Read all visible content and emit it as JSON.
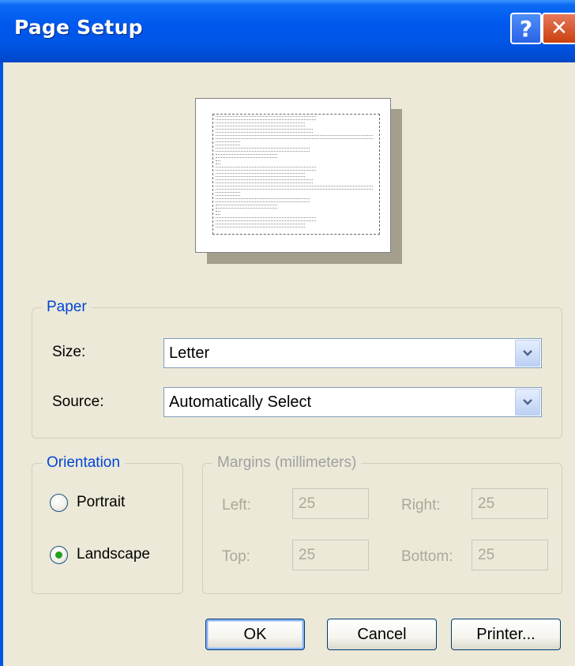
{
  "window": {
    "title": "Page Setup",
    "help_glyph": "?",
    "close_glyph": "✕"
  },
  "paper": {
    "group_title": "Paper",
    "size_label": "Size:",
    "size_value": "Letter",
    "source_label": "Source:",
    "source_value": "Automatically Select"
  },
  "orientation": {
    "group_title": "Orientation",
    "portrait_label": "Portrait",
    "landscape_label": "Landscape",
    "selected": "Landscape"
  },
  "margins": {
    "group_title": "Margins (millimeters)",
    "left_label": "Left:",
    "left_value": "25",
    "right_label": "Right:",
    "right_value": "25",
    "top_label": "Top:",
    "top_value": "25",
    "bottom_label": "Bottom:",
    "bottom_value": "25"
  },
  "buttons": {
    "ok": "OK",
    "cancel": "Cancel",
    "printer": "Printer..."
  },
  "colors": {
    "titlebar": "#0055E5",
    "dialog_bg": "#ECE9D8",
    "group_title": "#0046D5",
    "radio_selected": "#21A121",
    "close_button": "#C9400E"
  }
}
